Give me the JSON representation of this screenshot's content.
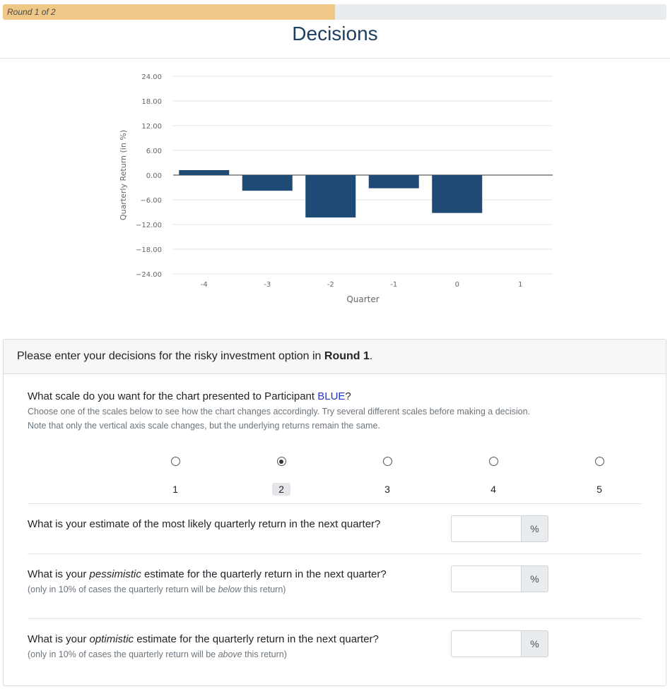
{
  "progress": {
    "label": "Round 1 of 2",
    "fraction": 0.5
  },
  "page_title": "Decisions",
  "chart_data": {
    "type": "bar",
    "categories": [
      "-4",
      "-3",
      "-2",
      "-1",
      "0",
      "1"
    ],
    "values": [
      1.2,
      -3.8,
      -10.3,
      -3.2,
      -9.2,
      null
    ],
    "xlabel": "Quarter",
    "ylabel": "Quarterly Return (in %)",
    "yticks": [
      "24.00",
      "18.00",
      "12.00",
      "6.00",
      "0.00",
      "−6.00",
      "−12.00",
      "−18.00",
      "−24.00"
    ],
    "ylim": [
      -24,
      24
    ],
    "grid": true,
    "bar_color": "#1f4a75"
  },
  "card": {
    "header_prefix": "Please enter your decisions for the risky investment option in ",
    "header_bold": "Round 1",
    "header_suffix": ".",
    "scale": {
      "question_prefix": "What scale do you want for the chart presented to Participant ",
      "participant": "BLUE",
      "question_suffix": "?",
      "help_1": "Choose one of the scales below to see how the chart changes accordingly. Try several different scales before making a decision.",
      "help_2": "Note that only the vertical axis scale changes, but the underlying returns remain the same.",
      "options": [
        "1",
        "2",
        "3",
        "4",
        "5"
      ],
      "selected": "2"
    },
    "q_likely": {
      "text": "What is your estimate of the most likely quarterly return in the next quarter?",
      "value": "",
      "unit": "%"
    },
    "q_pess": {
      "pre": "What is your ",
      "em": "pessimistic",
      "post": " estimate for the quarterly return in the next quarter?",
      "help_pre": "(only in 10% of cases the quarterly return will be ",
      "help_em": "below",
      "help_post": " this return)",
      "value": "",
      "unit": "%"
    },
    "q_opt": {
      "pre": "What is your ",
      "em": "optimistic",
      "post": " estimate for the quarterly return in the next quarter?",
      "help_pre": "(only in 10% of cases the quarterly return will be ",
      "help_em": "above",
      "help_post": " this return)",
      "value": "",
      "unit": "%"
    }
  },
  "colors": {
    "accent": "#1c3f63",
    "progress": "#efc787",
    "participant": "#2233cc"
  }
}
